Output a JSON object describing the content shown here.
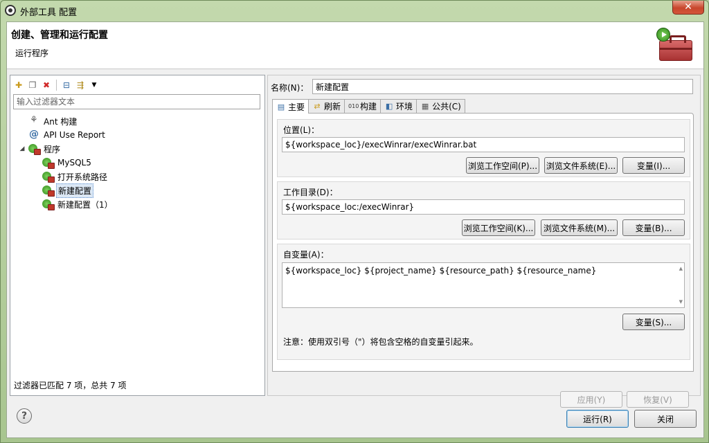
{
  "window": {
    "title": "外部工具 配置",
    "close_label": "✕"
  },
  "header": {
    "title": "创建、管理和运行配置",
    "subtitle": "运行程序"
  },
  "left_panel": {
    "toolbar": [
      "new-config-icon",
      "duplicate-icon",
      "delete-icon",
      "collapse-all-icon",
      "filter-icon",
      "dropdown-icon"
    ],
    "filter_placeholder": "输入过滤器文本",
    "tree": [
      {
        "label": "Ant 构建",
        "icon": "ant-icon",
        "level": 1
      },
      {
        "label": "API Use Report",
        "icon": "api-icon",
        "level": 1
      },
      {
        "label": "程序",
        "icon": "program-icon",
        "level": 1,
        "expanded": true
      },
      {
        "label": "MySQL5",
        "icon": "program-config-icon",
        "level": 2
      },
      {
        "label": "打开系统路径",
        "icon": "program-config-icon",
        "level": 2
      },
      {
        "label": "新建配置",
        "icon": "program-config-icon",
        "level": 2,
        "selected": true
      },
      {
        "label": "新建配置（1）",
        "icon": "program-config-icon",
        "level": 2
      }
    ],
    "status": "过滤器已匹配 7 项，总共 7 项"
  },
  "right_panel": {
    "name_label": "名称(N)：",
    "name_value": "新建配置",
    "tabs": [
      {
        "label": "主要",
        "icon": "main-tab-icon",
        "active": true
      },
      {
        "label": "刷新",
        "icon": "refresh-tab-icon"
      },
      {
        "label": "构建",
        "icon": "build-tab-icon"
      },
      {
        "label": "环境",
        "icon": "environment-tab-icon"
      },
      {
        "label": "公共(C)",
        "icon": "common-tab-icon"
      }
    ],
    "location": {
      "label": "位置(L)：",
      "value": "${workspace_loc}/execWinrar/execWinrar.bat",
      "browse_workspace": "浏览工作空间(P)...",
      "browse_filesystem": "浏览文件系统(E)...",
      "variables": "变量(I)..."
    },
    "working_dir": {
      "label": "工作目录(D)：",
      "value": "${workspace_loc:/execWinrar}",
      "browse_workspace": "浏览工作空间(K)...",
      "browse_filesystem": "浏览文件系统(M)...",
      "variables": "变量(B)..."
    },
    "arguments": {
      "label": "自变量(A)：",
      "value": "${workspace_loc} ${project_name} ${resource_path} ${resource_name}",
      "variables": "变量(S)...",
      "note": "注意：使用双引号（\"）将包含空格的自变量引起来。"
    },
    "apply": "应用(Y)",
    "revert": "恢复(V)"
  },
  "footer": {
    "help": "?",
    "run": "运行(R)",
    "close": "关闭"
  }
}
